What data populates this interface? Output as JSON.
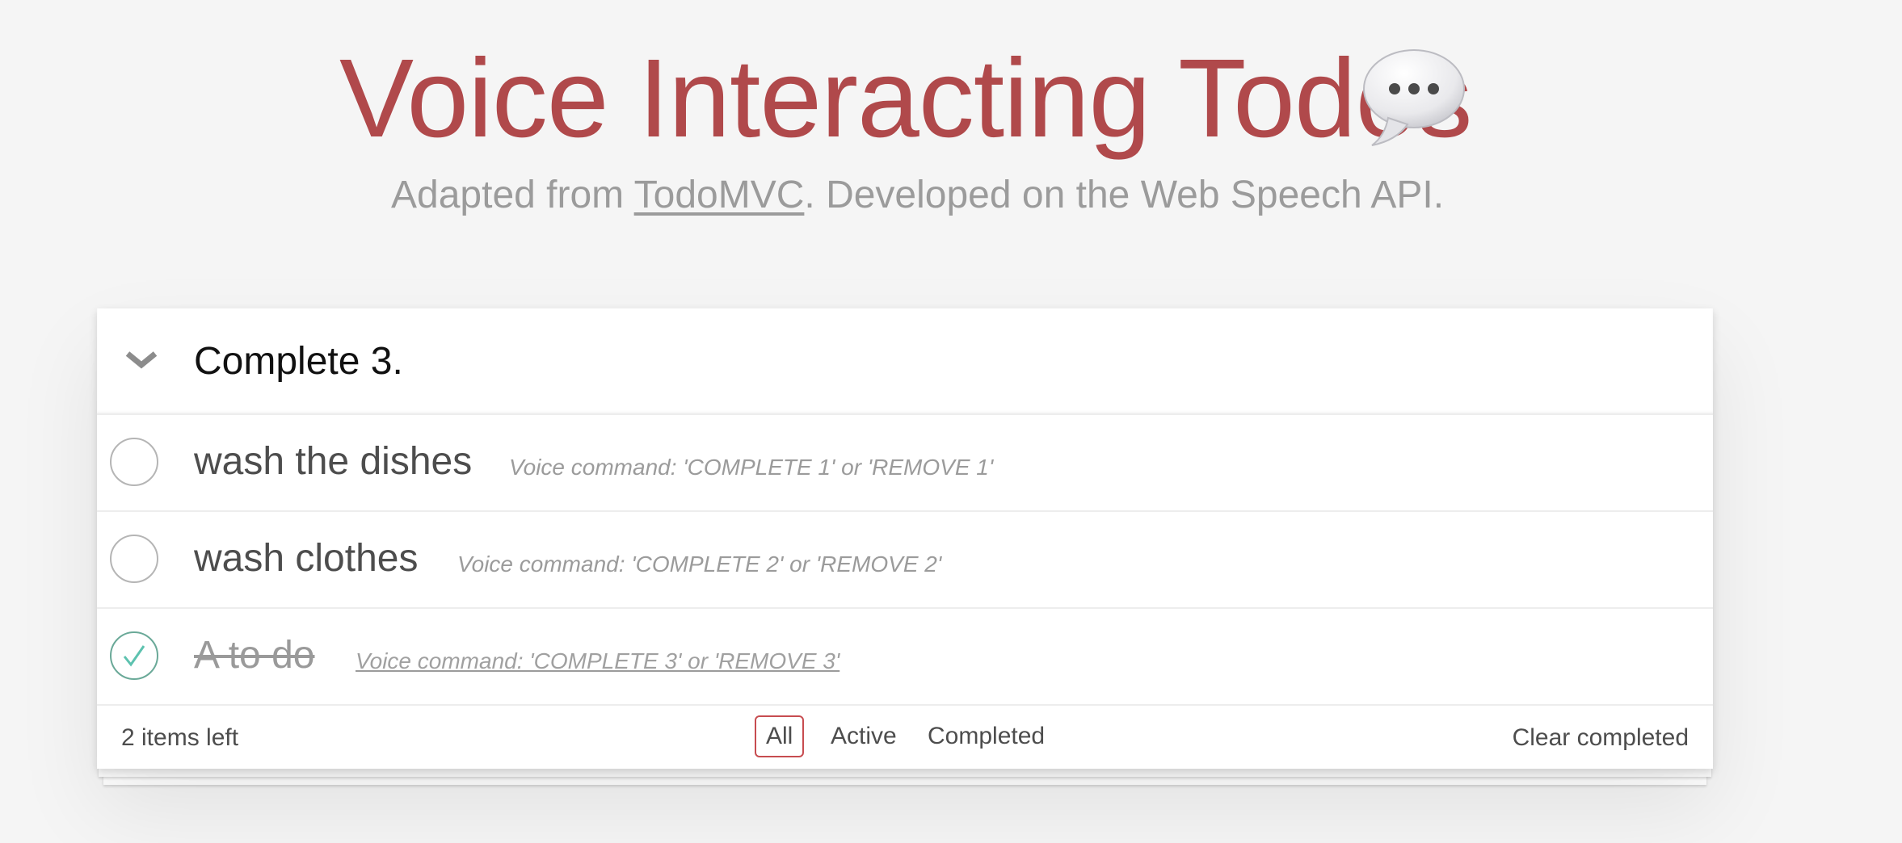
{
  "header": {
    "title": "Voice Interacting Todos",
    "subtitle_before": "Adapted from ",
    "subtitle_link": "TodoMVC",
    "subtitle_after": ". Developed on the Web Speech API.",
    "title_icon": "speech-balloon-icon"
  },
  "new_todo": {
    "value": "Complete 3.",
    "toggle_icon": "chevron-down-icon"
  },
  "todos": [
    {
      "label": "wash the dishes",
      "hint": "Voice command: 'COMPLETE 1' or 'REMOVE 1'",
      "completed": false
    },
    {
      "label": "wash clothes",
      "hint": "Voice command: 'COMPLETE 2' or 'REMOVE 2'",
      "completed": false
    },
    {
      "label": "A to do",
      "hint": "Voice command: 'COMPLETE 3' or 'REMOVE 3'",
      "completed": true
    }
  ],
  "footer": {
    "count": "2 items left",
    "filters": [
      {
        "label": "All",
        "selected": true
      },
      {
        "label": "Active",
        "selected": false
      },
      {
        "label": "Completed",
        "selected": false
      }
    ],
    "clear": "Clear completed"
  },
  "colors": {
    "title": "#b0494b",
    "selected_filter_border": "#c74c50",
    "check_done": "#6aa998",
    "background": "#f5f5f5"
  }
}
